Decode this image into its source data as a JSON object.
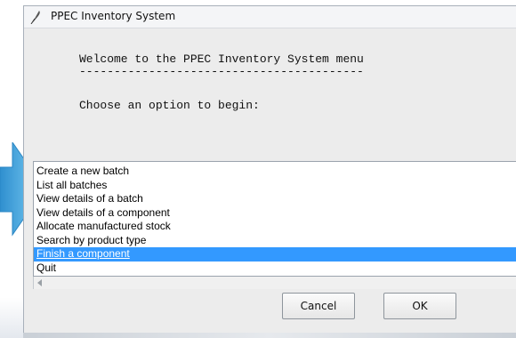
{
  "window": {
    "title": "PPEC Inventory System",
    "title_icon": "feather-icon"
  },
  "message": {
    "line1": "Welcome to the PPEC Inventory System menu",
    "line2": "-----------------------------------------",
    "line3": "Choose an option to begin:"
  },
  "list": {
    "items": [
      "Create a new batch",
      "List all batches",
      "View details of a batch",
      "View details of a component",
      "Allocate manufactured stock",
      "Search by product type",
      "Finish a component",
      "Quit"
    ],
    "selected_index": 6
  },
  "buttons": {
    "cancel": "Cancel",
    "ok": "OK"
  },
  "colors": {
    "selection": "#3399ff",
    "arrow": "#4fb3e8"
  }
}
